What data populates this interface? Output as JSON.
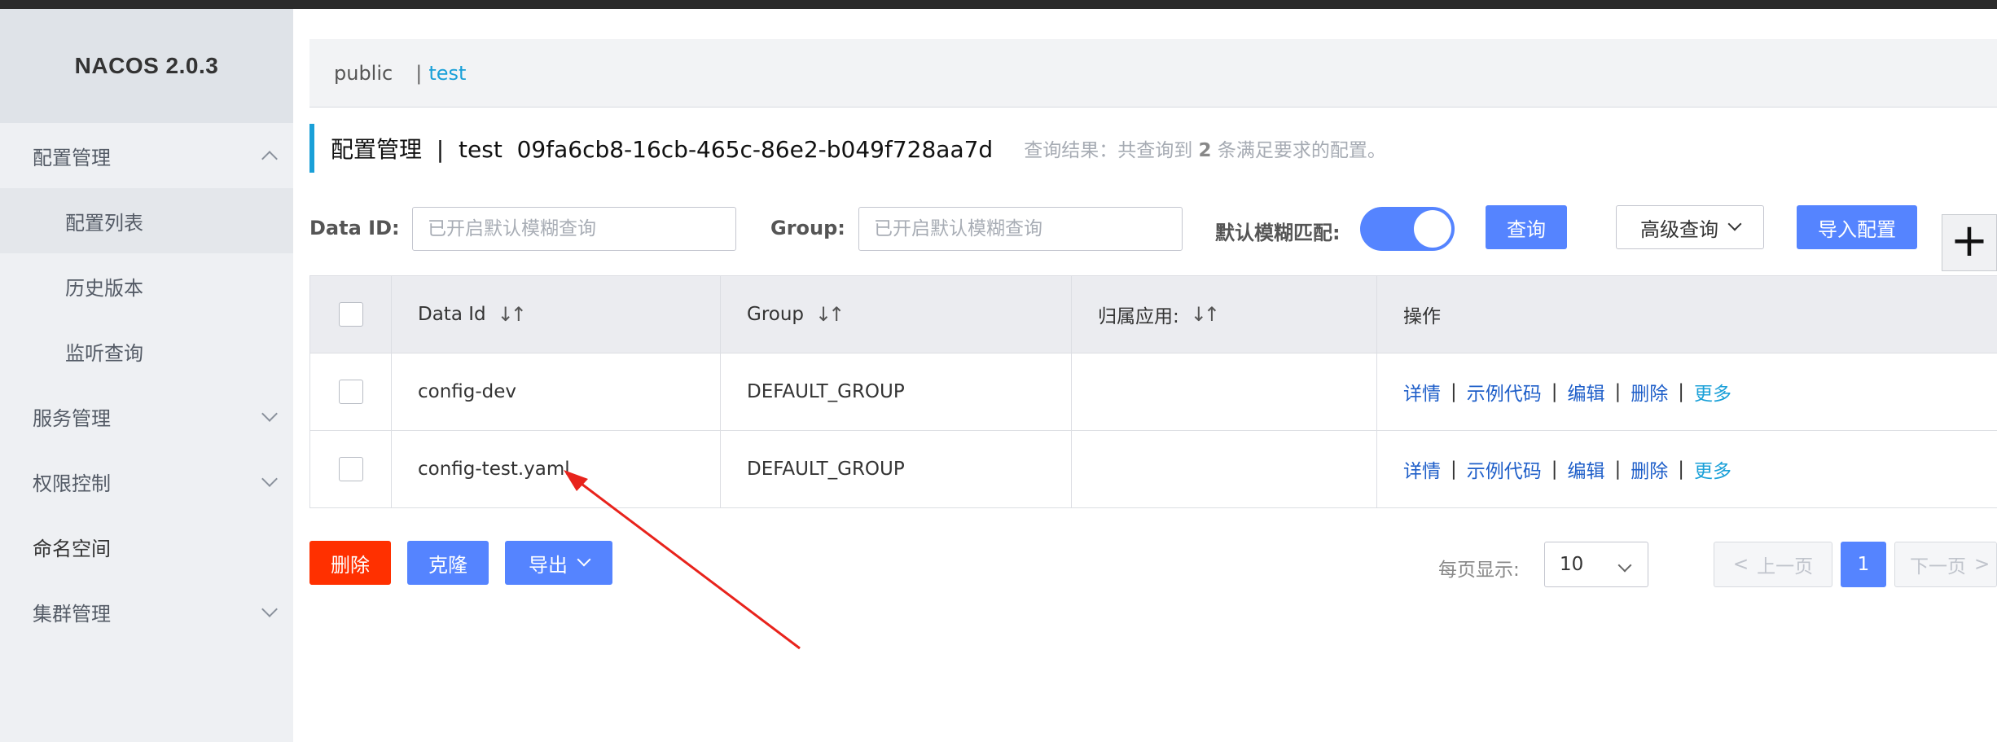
{
  "app": {
    "brand": "NACOS 2.0.3"
  },
  "sidebar": {
    "items": [
      {
        "label": "配置管理"
      },
      {
        "label": "配置列表"
      },
      {
        "label": "历史版本"
      },
      {
        "label": "监听查询"
      },
      {
        "label": "服务管理"
      },
      {
        "label": "权限控制"
      },
      {
        "label": "命名空间"
      },
      {
        "label": "集群管理"
      }
    ]
  },
  "namespace": {
    "public": "public",
    "separator": "|",
    "current": "test"
  },
  "title": {
    "text": "配置管理  |  test  09fa6cb8-16cb-465c-86e2-b049f728aa7d",
    "result_prefix": "查询结果：共查询到 ",
    "result_count": "2",
    "result_suffix": " 条满足要求的配置。"
  },
  "search": {
    "dataid_label": "Data ID:",
    "dataid_placeholder": "已开启默认模糊查询",
    "group_label": "Group:",
    "group_placeholder": "已开启默认模糊查询",
    "fuzzy_label": "默认模糊匹配:",
    "fuzzy_enabled": true,
    "query_button": "查询",
    "advanced_button": "高级查询",
    "import_button": "导入配置",
    "add_symbol": "+"
  },
  "table": {
    "headers": {
      "dataid": "Data Id",
      "group": "Group",
      "app": "归属应用:",
      "ops": "操作",
      "sort_symbol": "↓↑"
    },
    "rows": [
      {
        "dataid": "config-dev",
        "group": "DEFAULT_GROUP",
        "app": ""
      },
      {
        "dataid": "config-test.yaml",
        "group": "DEFAULT_GROUP",
        "app": ""
      }
    ],
    "ops": {
      "detail": "详情",
      "sample": "示例代码",
      "edit": "编辑",
      "delete": "删除",
      "more": "更多",
      "sep": "|"
    }
  },
  "footer": {
    "delete_button": "删除",
    "clone_button": "克隆",
    "export_button": "导出",
    "page_size_label": "每页显示:",
    "page_size": "10",
    "prev": "上一页",
    "current_page": "1",
    "next": "下一页"
  },
  "colors": {
    "primary": "#5584ff",
    "danger": "#ff3000",
    "link": "#1f5fc9",
    "accent": "#1aa0d8",
    "annotation": "#e8231c"
  }
}
